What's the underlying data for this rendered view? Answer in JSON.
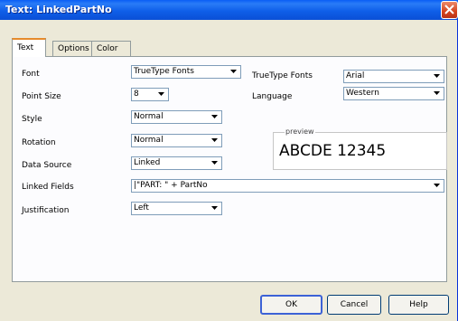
{
  "window": {
    "title": "Text: LinkedPartNo"
  },
  "tabs": [
    {
      "label": "Text"
    },
    {
      "label": "Options"
    },
    {
      "label": "Color"
    }
  ],
  "form": {
    "font": {
      "label": "Font",
      "value": "TrueType Fonts"
    },
    "truetype_fonts": {
      "label": "TrueType Fonts",
      "value": "Arial"
    },
    "point_size": {
      "label": "Point Size",
      "value": "8"
    },
    "language": {
      "label": "Language",
      "value": "Western"
    },
    "style": {
      "label": "Style",
      "value": "Normal"
    },
    "rotation": {
      "label": "Rotation",
      "value": "Normal"
    },
    "data_source": {
      "label": "Data Source",
      "value": "Linked"
    },
    "linked_fields": {
      "label": "Linked Fields",
      "value": "|\"PART: \" + PartNo"
    },
    "justification": {
      "label": "Justification",
      "value": "Left"
    }
  },
  "preview": {
    "legend": "preview",
    "text": "ABCDE 12345"
  },
  "buttons": {
    "ok": "OK",
    "cancel": "Cancel",
    "help": "Help"
  },
  "colors": {
    "titlebar": "#0a5ef5",
    "dialog_bg": "#ece9d8",
    "panel_bg": "#fcfcfe",
    "active_tab_accent": "#e68b2c"
  }
}
